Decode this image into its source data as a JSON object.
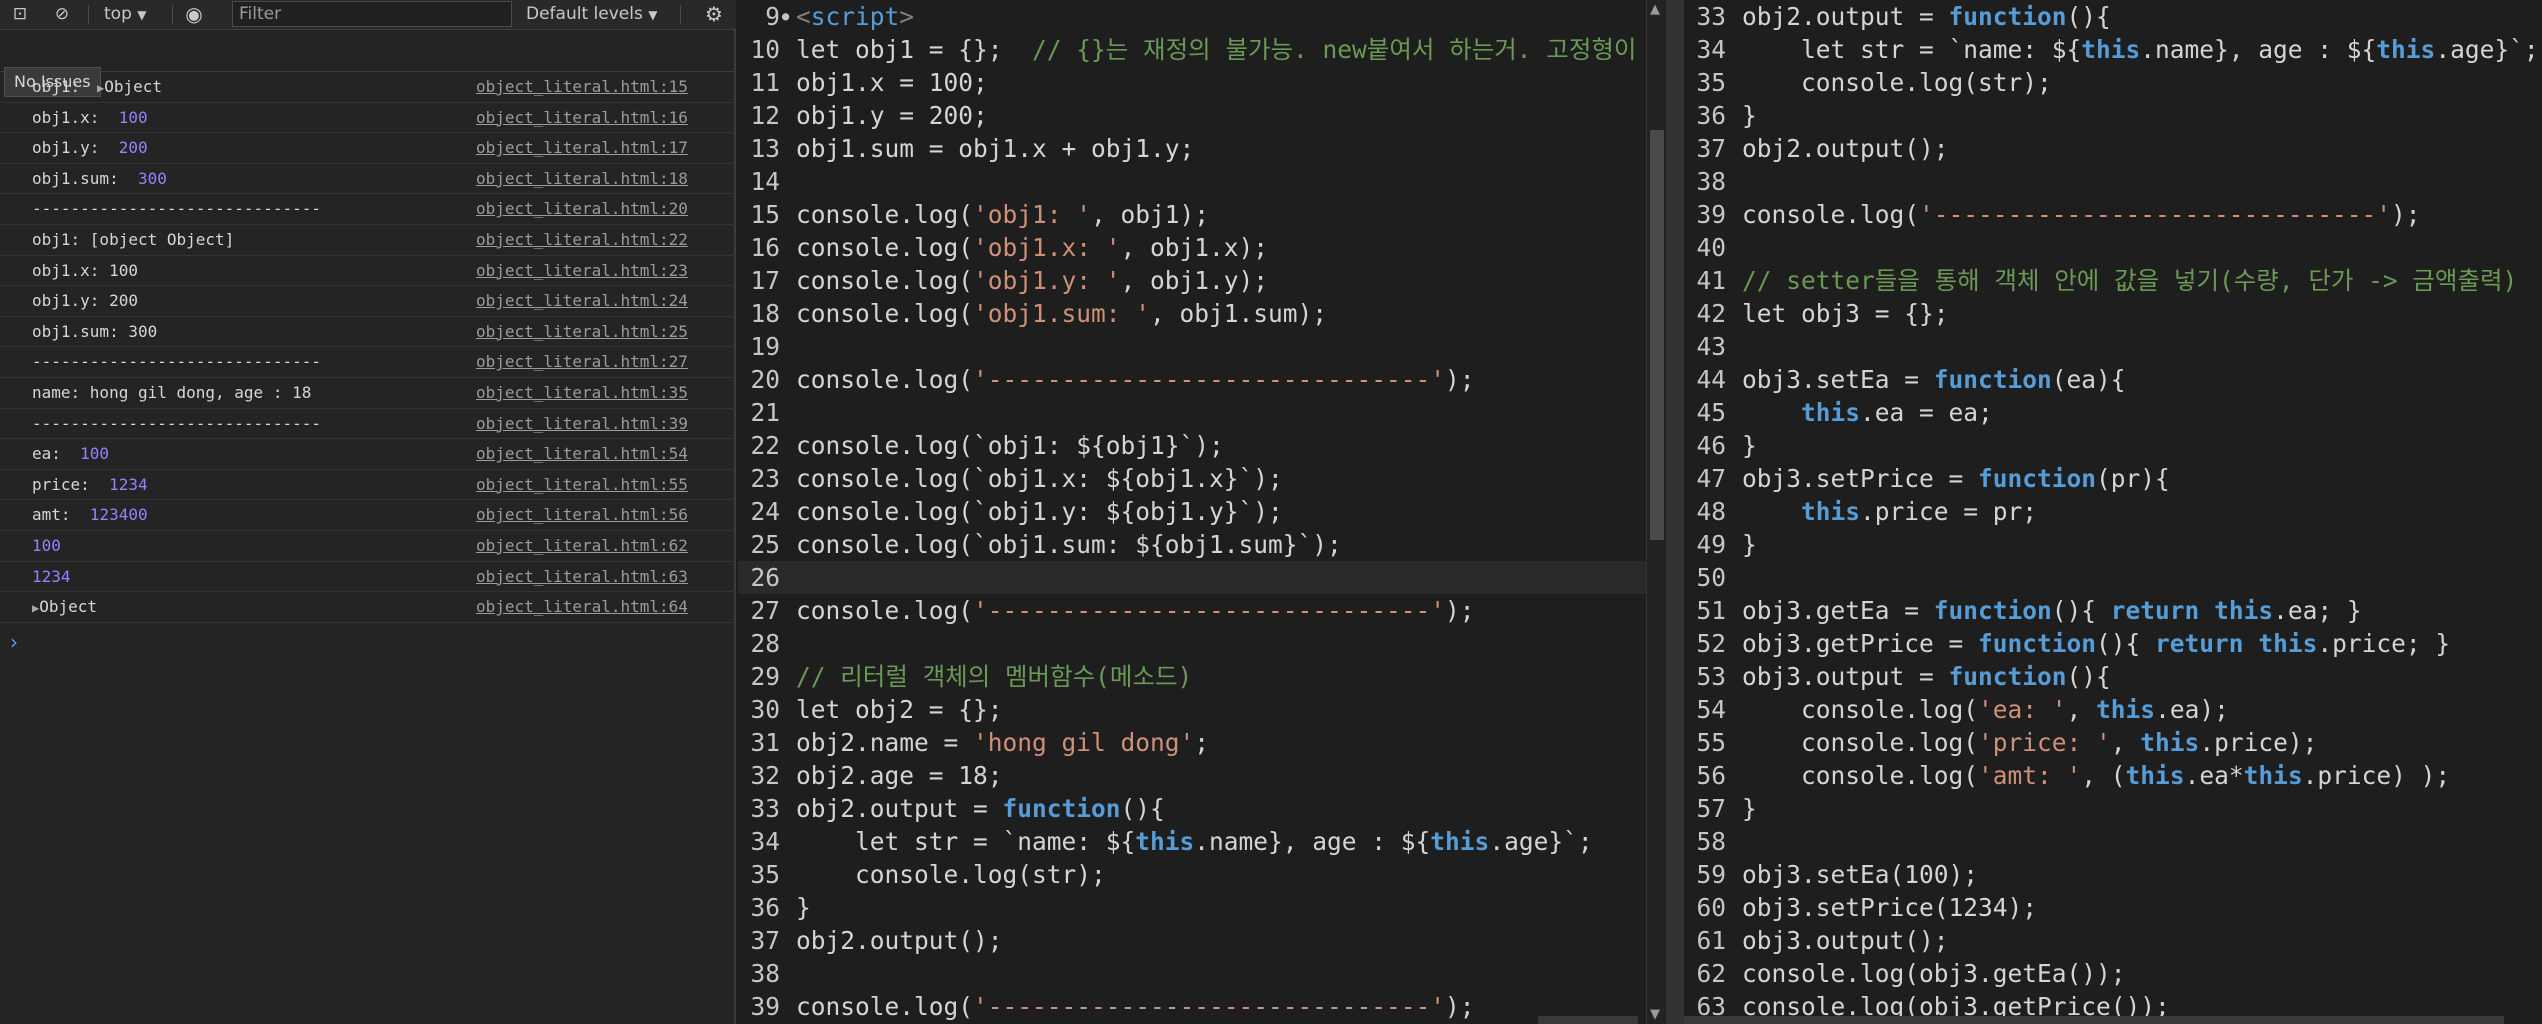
{
  "toolbar": {
    "context": "top",
    "filter_placeholder": "Filter",
    "levels_label": "Default levels",
    "issues_label": "No Issues"
  },
  "console_log": [
    {
      "text": "obj1: ",
      "value": "Object",
      "value_type": "expandable",
      "source": "object_literal.html:15"
    },
    {
      "text": "obj1.x: ",
      "value": "100",
      "value_type": "number",
      "source": "object_literal.html:16"
    },
    {
      "text": "obj1.y: ",
      "value": "200",
      "value_type": "number",
      "source": "object_literal.html:17"
    },
    {
      "text": "obj1.sum: ",
      "value": "300",
      "value_type": "number",
      "source": "object_literal.html:18"
    },
    {
      "text": "------------------------------",
      "value": "",
      "value_type": "none",
      "source": "object_literal.html:20"
    },
    {
      "text": "obj1: [object Object]",
      "value": "",
      "value_type": "none",
      "source": "object_literal.html:22"
    },
    {
      "text": "obj1.x: 100",
      "value": "",
      "value_type": "none",
      "source": "object_literal.html:23"
    },
    {
      "text": "obj1.y: 200",
      "value": "",
      "value_type": "none",
      "source": "object_literal.html:24"
    },
    {
      "text": "obj1.sum: 300",
      "value": "",
      "value_type": "none",
      "source": "object_literal.html:25"
    },
    {
      "text": "------------------------------",
      "value": "",
      "value_type": "none",
      "source": "object_literal.html:27"
    },
    {
      "text": "name: hong gil dong, age : 18",
      "value": "",
      "value_type": "none",
      "source": "object_literal.html:35"
    },
    {
      "text": "------------------------------",
      "value": "",
      "value_type": "none",
      "source": "object_literal.html:39"
    },
    {
      "text": "ea: ",
      "value": "100",
      "value_type": "number",
      "source": "object_literal.html:54"
    },
    {
      "text": "price: ",
      "value": "1234",
      "value_type": "number",
      "source": "object_literal.html:55"
    },
    {
      "text": "amt: ",
      "value": "123400",
      "value_type": "number",
      "source": "object_literal.html:56"
    },
    {
      "text": "",
      "value": "100",
      "value_type": "number",
      "source": "object_literal.html:62"
    },
    {
      "text": "",
      "value": "1234",
      "value_type": "number",
      "source": "object_literal.html:63"
    },
    {
      "text": "",
      "value": "Object",
      "value_type": "expandable",
      "source": "object_literal.html:64"
    }
  ],
  "editor_left": {
    "lines": [
      {
        "n": "9",
        "fold": true,
        "tokens": [
          [
            "ang",
            "<"
          ],
          [
            "tag",
            "script"
          ],
          [
            "ang",
            ">"
          ]
        ]
      },
      {
        "n": "10",
        "tokens": [
          [
            "",
            "let obj1 = {};  "
          ],
          [
            "cmt",
            "// {}는 재정의 불가능. new붙여서 하는거. 고정형이"
          ]
        ]
      },
      {
        "n": "11",
        "tokens": [
          [
            "",
            "obj1.x = 100;"
          ]
        ]
      },
      {
        "n": "12",
        "tokens": [
          [
            "",
            "obj1.y = 200;"
          ]
        ]
      },
      {
        "n": "13",
        "tokens": [
          [
            "",
            "obj1.sum = obj1.x + obj1.y;"
          ]
        ]
      },
      {
        "n": "14",
        "tokens": []
      },
      {
        "n": "15",
        "tokens": [
          [
            "",
            "console.log("
          ],
          [
            "str",
            "'obj1: '"
          ],
          [
            "",
            ", obj1);"
          ]
        ]
      },
      {
        "n": "16",
        "tokens": [
          [
            "",
            "console.log("
          ],
          [
            "str",
            "'obj1.x: '"
          ],
          [
            "",
            ", obj1.x);"
          ]
        ]
      },
      {
        "n": "17",
        "tokens": [
          [
            "",
            "console.log("
          ],
          [
            "str",
            "'obj1.y: '"
          ],
          [
            "",
            ", obj1.y);"
          ]
        ]
      },
      {
        "n": "18",
        "tokens": [
          [
            "",
            "console.log("
          ],
          [
            "str",
            "'obj1.sum: '"
          ],
          [
            "",
            ", obj1.sum);"
          ]
        ]
      },
      {
        "n": "19",
        "tokens": []
      },
      {
        "n": "20",
        "tokens": [
          [
            "",
            "console.log("
          ],
          [
            "str",
            "'------------------------------'"
          ],
          [
            "",
            ");"
          ]
        ]
      },
      {
        "n": "21",
        "tokens": []
      },
      {
        "n": "22",
        "tokens": [
          [
            "",
            "console.log(`obj1: ${obj1}`);"
          ]
        ]
      },
      {
        "n": "23",
        "tokens": [
          [
            "",
            "console.log(`obj1.x: ${obj1.x}`);"
          ]
        ]
      },
      {
        "n": "24",
        "tokens": [
          [
            "",
            "console.log(`obj1.y: ${obj1.y}`);"
          ]
        ]
      },
      {
        "n": "25",
        "tokens": [
          [
            "",
            "console.log(`obj1.sum: ${obj1.sum}`);"
          ]
        ]
      },
      {
        "n": "26",
        "current": true,
        "tokens": []
      },
      {
        "n": "27",
        "tokens": [
          [
            "",
            "console.log("
          ],
          [
            "str",
            "'------------------------------'"
          ],
          [
            "",
            ");"
          ]
        ]
      },
      {
        "n": "28",
        "tokens": []
      },
      {
        "n": "29",
        "tokens": [
          [
            "cmt",
            "// 리터럴 객체의 멤버함수(메소드)"
          ]
        ]
      },
      {
        "n": "30",
        "tokens": [
          [
            "",
            "let obj2 = {};"
          ]
        ]
      },
      {
        "n": "31",
        "tokens": [
          [
            "",
            "obj2.name = "
          ],
          [
            "str",
            "'hong gil dong'"
          ],
          [
            "",
            ";"
          ]
        ]
      },
      {
        "n": "32",
        "tokens": [
          [
            "",
            "obj2.age = 18;"
          ]
        ]
      },
      {
        "n": "33",
        "tokens": [
          [
            "",
            "obj2.output = "
          ],
          [
            "kw",
            "function"
          ],
          [
            "",
            "(){"
          ]
        ]
      },
      {
        "n": "34",
        "tokens": [
          [
            "",
            "    let str = `name: ${"
          ],
          [
            "kw",
            "this"
          ],
          [
            "",
            ".name}, age : ${"
          ],
          [
            "kw",
            "this"
          ],
          [
            "",
            ".age}`;"
          ]
        ]
      },
      {
        "n": "35",
        "tokens": [
          [
            "",
            "    console.log(str);"
          ]
        ]
      },
      {
        "n": "36",
        "tokens": [
          [
            "",
            "}"
          ]
        ]
      },
      {
        "n": "37",
        "tokens": [
          [
            "",
            "obj2.output();"
          ]
        ]
      },
      {
        "n": "38",
        "tokens": []
      },
      {
        "n": "39",
        "tokens": [
          [
            "",
            "console.log("
          ],
          [
            "str",
            "'------------------------------'"
          ],
          [
            "",
            ");"
          ]
        ]
      }
    ]
  },
  "editor_right": {
    "lines": [
      {
        "n": "33",
        "tokens": [
          [
            "",
            "obj2.output = "
          ],
          [
            "kw",
            "function"
          ],
          [
            "",
            "(){"
          ]
        ]
      },
      {
        "n": "34",
        "tokens": [
          [
            "",
            "    let str = `name: ${"
          ],
          [
            "kw",
            "this"
          ],
          [
            "",
            ".name}, age : ${"
          ],
          [
            "kw",
            "this"
          ],
          [
            "",
            ".age}`;"
          ]
        ]
      },
      {
        "n": "35",
        "tokens": [
          [
            "",
            "    console.log(str);"
          ]
        ]
      },
      {
        "n": "36",
        "tokens": [
          [
            "",
            "}"
          ]
        ]
      },
      {
        "n": "37",
        "tokens": [
          [
            "",
            "obj2.output();"
          ]
        ]
      },
      {
        "n": "38",
        "tokens": []
      },
      {
        "n": "39",
        "tokens": [
          [
            "",
            "console.log("
          ],
          [
            "str",
            "'------------------------------'"
          ],
          [
            "",
            ");"
          ]
        ]
      },
      {
        "n": "40",
        "tokens": []
      },
      {
        "n": "41",
        "tokens": [
          [
            "cmt",
            "// setter들을 통해 객체 안에 값을 넣기(수량, 단가 -> 금액출력)"
          ]
        ]
      },
      {
        "n": "42",
        "tokens": [
          [
            "",
            "let obj3 = {};"
          ]
        ]
      },
      {
        "n": "43",
        "tokens": []
      },
      {
        "n": "44",
        "tokens": [
          [
            "",
            "obj3.setEa = "
          ],
          [
            "kw",
            "function"
          ],
          [
            "",
            "(ea){"
          ]
        ]
      },
      {
        "n": "45",
        "tokens": [
          [
            "",
            "    "
          ],
          [
            "kw",
            "this"
          ],
          [
            "",
            ".ea = ea;"
          ]
        ]
      },
      {
        "n": "46",
        "tokens": [
          [
            "",
            "}"
          ]
        ]
      },
      {
        "n": "47",
        "tokens": [
          [
            "",
            "obj3.setPrice = "
          ],
          [
            "kw",
            "function"
          ],
          [
            "",
            "(pr){"
          ]
        ]
      },
      {
        "n": "48",
        "tokens": [
          [
            "",
            "    "
          ],
          [
            "kw",
            "this"
          ],
          [
            "",
            ".price = pr;"
          ]
        ]
      },
      {
        "n": "49",
        "tokens": [
          [
            "",
            "}"
          ]
        ]
      },
      {
        "n": "50",
        "tokens": []
      },
      {
        "n": "51",
        "tokens": [
          [
            "",
            "obj3.getEa = "
          ],
          [
            "kw",
            "function"
          ],
          [
            "",
            "(){ "
          ],
          [
            "kw",
            "return"
          ],
          [
            "",
            " "
          ],
          [
            "kw",
            "this"
          ],
          [
            "",
            ".ea; }"
          ]
        ]
      },
      {
        "n": "52",
        "tokens": [
          [
            "",
            "obj3.getPrice = "
          ],
          [
            "kw",
            "function"
          ],
          [
            "",
            "(){ "
          ],
          [
            "kw",
            "return"
          ],
          [
            "",
            " "
          ],
          [
            "kw",
            "this"
          ],
          [
            "",
            ".price; }"
          ]
        ]
      },
      {
        "n": "53",
        "tokens": [
          [
            "",
            "obj3.output = "
          ],
          [
            "kw",
            "function"
          ],
          [
            "",
            "(){"
          ]
        ]
      },
      {
        "n": "54",
        "tokens": [
          [
            "",
            "    console.log("
          ],
          [
            "str",
            "'ea: '"
          ],
          [
            "",
            ", "
          ],
          [
            "kw",
            "this"
          ],
          [
            "",
            ".ea);"
          ]
        ]
      },
      {
        "n": "55",
        "tokens": [
          [
            "",
            "    console.log("
          ],
          [
            "str",
            "'price: '"
          ],
          [
            "",
            ", "
          ],
          [
            "kw",
            "this"
          ],
          [
            "",
            ".price);"
          ]
        ]
      },
      {
        "n": "56",
        "tokens": [
          [
            "",
            "    console.log("
          ],
          [
            "str",
            "'amt: '"
          ],
          [
            "",
            ", ("
          ],
          [
            "kw",
            "this"
          ],
          [
            "",
            ".ea*"
          ],
          [
            "kw",
            "this"
          ],
          [
            "",
            ".price) );"
          ]
        ]
      },
      {
        "n": "57",
        "tokens": [
          [
            "",
            "}"
          ]
        ]
      },
      {
        "n": "58",
        "tokens": []
      },
      {
        "n": "59",
        "tokens": [
          [
            "",
            "obj3.setEa(100);"
          ]
        ]
      },
      {
        "n": "60",
        "tokens": [
          [
            "",
            "obj3.setPrice(1234);"
          ]
        ]
      },
      {
        "n": "61",
        "tokens": [
          [
            "",
            "obj3.output();"
          ]
        ]
      },
      {
        "n": "62",
        "tokens": [
          [
            "",
            "console.log(obj3.getEa());"
          ]
        ]
      },
      {
        "n": "63",
        "tokens": [
          [
            "",
            "console.log(obj3.getPrice());"
          ]
        ]
      }
    ]
  }
}
